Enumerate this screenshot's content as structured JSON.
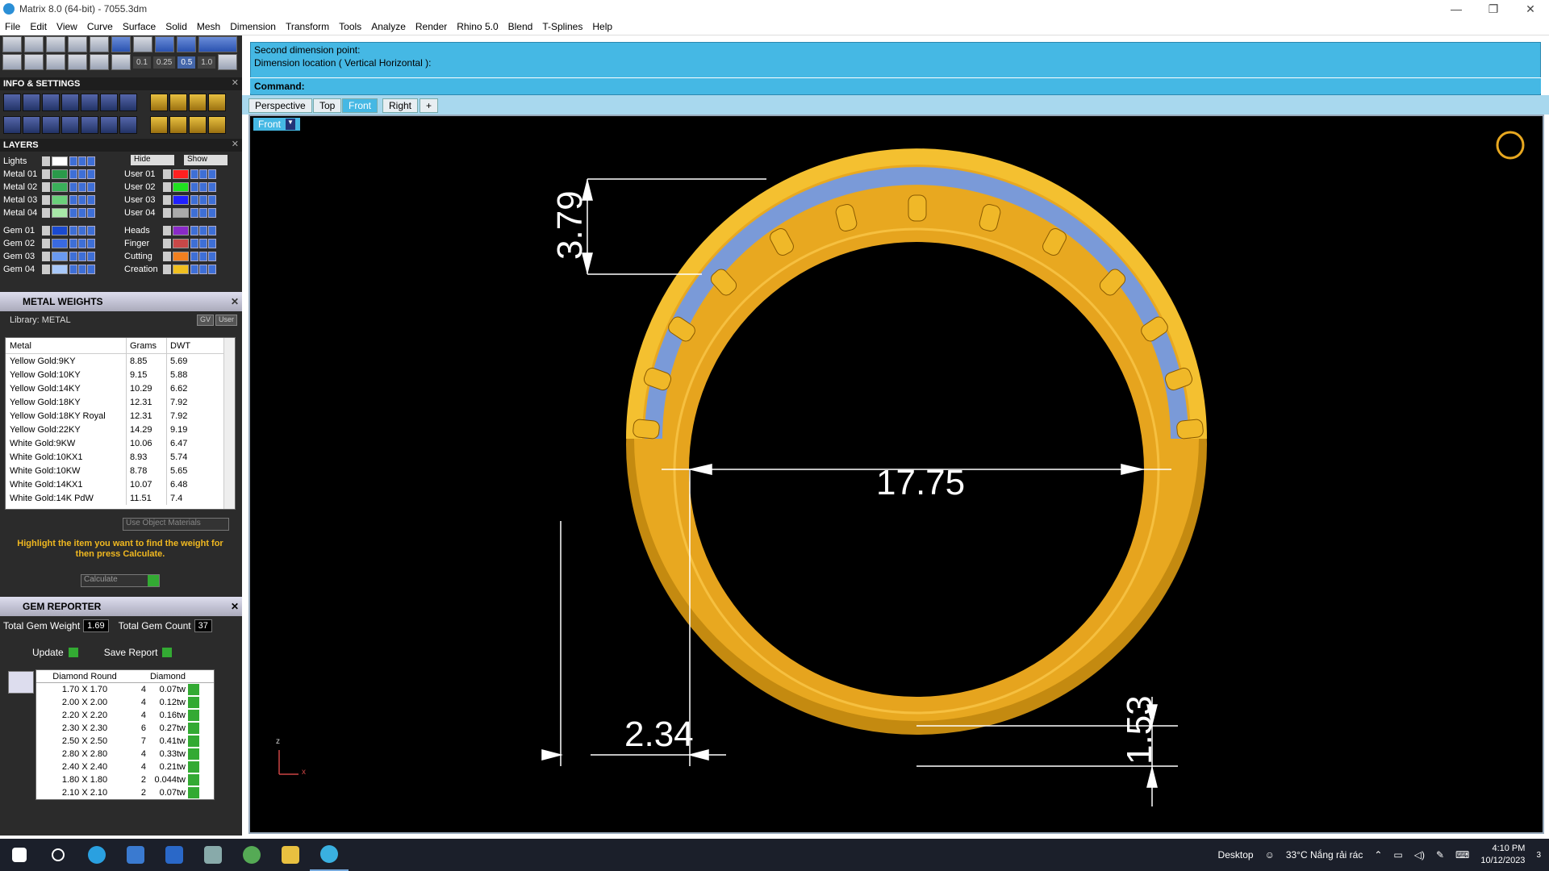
{
  "window": {
    "title": "Matrix 8.0 (64-bit) - 7055.3dm"
  },
  "menu": [
    "File",
    "Edit",
    "View",
    "Curve",
    "Surface",
    "Solid",
    "Mesh",
    "Dimension",
    "Transform",
    "Tools",
    "Analyze",
    "Render",
    "Rhino 5.0",
    "Blend",
    "T-Splines",
    "Help"
  ],
  "toolbar": {
    "snap_values": [
      "0.1",
      "0.25",
      "0.5",
      "1.0"
    ]
  },
  "info_settings": {
    "title": "INFO & SETTINGS"
  },
  "layers": {
    "title": "LAYERS",
    "hide_label": "Hide",
    "show_label": "Show",
    "left": [
      {
        "name": "Lights",
        "color": "#ffffff"
      },
      {
        "name": "Metal 01",
        "color": "#2a9a4a"
      },
      {
        "name": "Metal 02",
        "color": "#3ab05a"
      },
      {
        "name": "Metal 03",
        "color": "#6ad07a"
      },
      {
        "name": "Metal 04",
        "color": "#a8e8a8"
      },
      {
        "name": "Gem 01",
        "color": "#1a4ad0"
      },
      {
        "name": "Gem 02",
        "color": "#3a6ae0"
      },
      {
        "name": "Gem 03",
        "color": "#6a9af0"
      },
      {
        "name": "Gem 04",
        "color": "#a8c8f8"
      }
    ],
    "right": [
      {
        "name": "User 01",
        "color": "#ff2020"
      },
      {
        "name": "User 02",
        "color": "#20e020"
      },
      {
        "name": "User 03",
        "color": "#2020ff"
      },
      {
        "name": "User 04",
        "color": "#aaaaaa"
      },
      {
        "name": "Heads",
        "color": "#8a2ac8"
      },
      {
        "name": "Finger",
        "color": "#c84848"
      },
      {
        "name": "Cutting",
        "color": "#f08020"
      },
      {
        "name": "Creation",
        "color": "#f0c020"
      }
    ]
  },
  "metal_weights": {
    "title": "METAL WEIGHTS",
    "library": "Library: METAL",
    "lib_btns": [
      "GV",
      "User"
    ],
    "columns": [
      "Metal",
      "Grams",
      "DWT"
    ],
    "rows": [
      [
        "Yellow Gold:9KY",
        "8.85",
        "5.69"
      ],
      [
        "Yellow Gold:10KY",
        "9.15",
        "5.88"
      ],
      [
        "Yellow Gold:14KY",
        "10.29",
        "6.62"
      ],
      [
        "Yellow Gold:18KY",
        "12.31",
        "7.92"
      ],
      [
        "Yellow Gold:18KY Royal",
        "12.31",
        "7.92"
      ],
      [
        "Yellow Gold:22KY",
        "14.29",
        "9.19"
      ],
      [
        "White Gold:9KW",
        "10.06",
        "6.47"
      ],
      [
        "White Gold:10KX1",
        "8.93",
        "5.74"
      ],
      [
        "White Gold:10KW",
        "8.78",
        "5.65"
      ],
      [
        "White Gold:14KX1",
        "10.07",
        "6.48"
      ],
      [
        "White Gold:14K PdW",
        "11.51",
        "7.4"
      ]
    ],
    "use_object_materials": "Use Object Materials",
    "hint": "Highlight the item you want to find the weight for then press Calculate.",
    "calculate": "Calculate"
  },
  "gem_reporter": {
    "title": "GEM REPORTER",
    "total_weight_label": "Total Gem Weight",
    "total_weight": "1.69",
    "total_count_label": "Total Gem Count",
    "total_count": "37",
    "update": "Update",
    "save_report": "Save Report",
    "columns": [
      "Diamond Round",
      "",
      "Diamond"
    ],
    "rows": [
      [
        "1.70 X 1.70",
        "4",
        "0.07tw"
      ],
      [
        "2.00 X 2.00",
        "4",
        "0.12tw"
      ],
      [
        "2.20 X 2.20",
        "4",
        "0.16tw"
      ],
      [
        "2.30 X 2.30",
        "6",
        "0.27tw"
      ],
      [
        "2.50 X 2.50",
        "7",
        "0.41tw"
      ],
      [
        "2.80 X 2.80",
        "4",
        "0.33tw"
      ],
      [
        "2.40 X 2.40",
        "4",
        "0.21tw"
      ],
      [
        "1.80 X 1.80",
        "2",
        "0.044tw"
      ],
      [
        "2.10 X 2.10",
        "2",
        "0.07tw"
      ]
    ]
  },
  "command": {
    "line1": "Second dimension point:",
    "line2": "Dimension location ( Vertical  Horizontal ):",
    "prompt": "Command:"
  },
  "viewport_tabs": [
    "Perspective",
    "Top",
    "Front",
    "Right"
  ],
  "active_tab": "Front",
  "viewport": {
    "label": "Front",
    "dims": {
      "inner_diameter": "17.75",
      "top_height": "3.79",
      "bottom_width": "2.34",
      "bottom_height": "1.53"
    },
    "axis_labels": {
      "z": "z",
      "x": "x"
    }
  },
  "taskbar": {
    "desktop": "Desktop",
    "weather": "33°C  Nắng rải rác",
    "time": "4:10 PM",
    "date": "10/12/2023",
    "notifications": "3"
  }
}
